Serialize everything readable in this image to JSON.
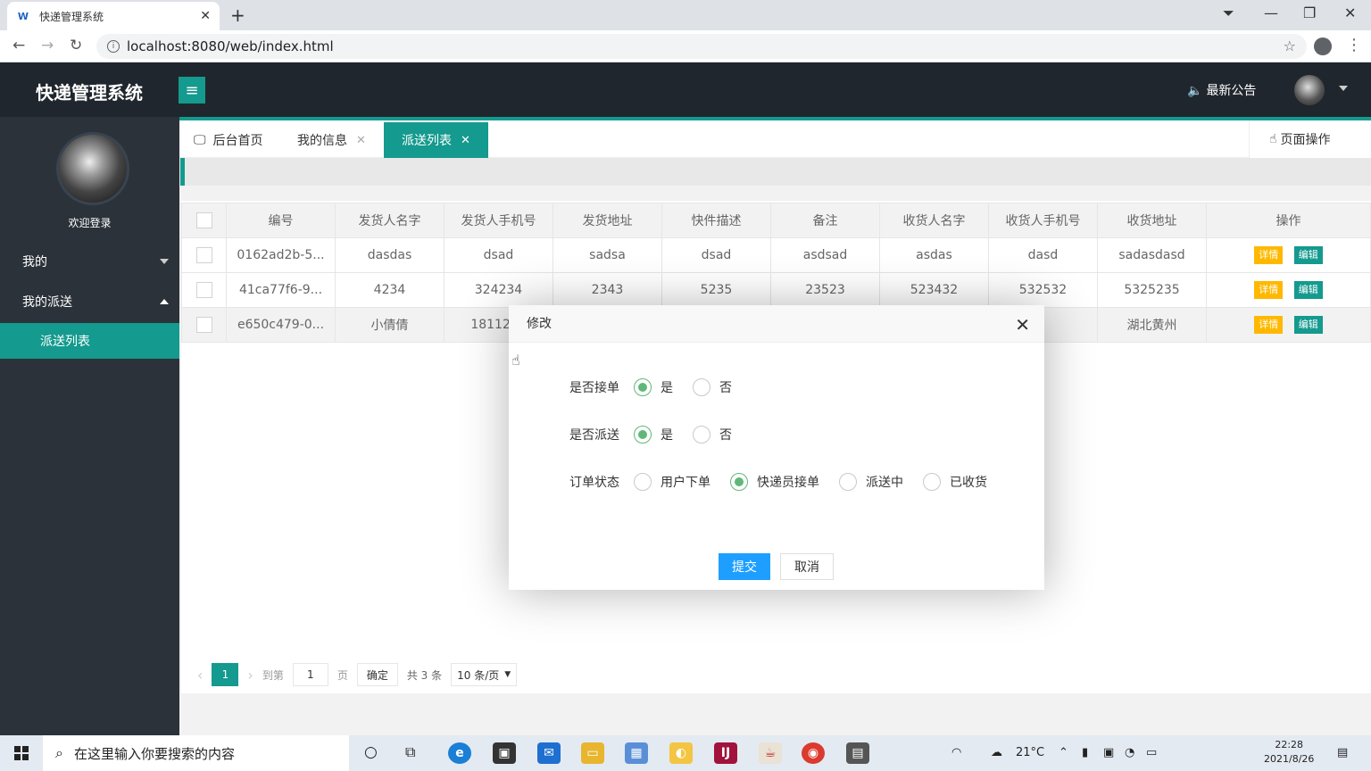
{
  "browser": {
    "tab_title": "快递管理系统",
    "tab_close": "✕",
    "new_tab": "+",
    "url": "localhost:8080/web/index.html"
  },
  "header": {
    "app_title": "快递管理系统",
    "menu_icon": "≡",
    "notice": "最新公告"
  },
  "sidebar": {
    "welcome": "欢迎登录",
    "items": [
      {
        "label": "我的"
      },
      {
        "label": "我的派送"
      }
    ],
    "sub_item": "派送列表"
  },
  "tabs": {
    "items": [
      {
        "label": "后台首页"
      },
      {
        "label": "我的信息"
      },
      {
        "label": "派送列表"
      }
    ],
    "close": "✕",
    "page_ops": "页面操作"
  },
  "table": {
    "columns": [
      "编号",
      "发货人名字",
      "发货人手机号",
      "发货地址",
      "快件描述",
      "备注",
      "收货人名字",
      "收货人手机号",
      "收货地址",
      "操作"
    ],
    "rows": [
      [
        "0162ad2b-5...",
        "dasdas",
        "dsad",
        "sadsa",
        "dsad",
        "asdsad",
        "asdas",
        "dasd",
        "sadasdasd"
      ],
      [
        "41ca77f6-9...",
        "4234",
        "324234",
        "2343",
        "5235",
        "23523",
        "523432",
        "532532",
        "5325235"
      ],
      [
        "e650c479-0...",
        "小倩倩",
        "1811234",
        "",
        "",
        "",
        "",
        "12222",
        "湖北黄州"
      ]
    ],
    "detail_btn": "详情",
    "edit_btn": "编辑"
  },
  "pager": {
    "prev": "‹",
    "current": "1",
    "next": "›",
    "goto_label": "到第",
    "goto_value": "1",
    "page_label": "页",
    "ok": "确定",
    "total": "共 3 条",
    "page_size": "10 条/页"
  },
  "modal": {
    "title": "修改",
    "close": "✕",
    "fields": [
      {
        "label": "是否接单",
        "options": [
          "是",
          "否"
        ],
        "selected": 0
      },
      {
        "label": "是否派送",
        "options": [
          "是",
          "否"
        ],
        "selected": 0
      },
      {
        "label": "订单状态",
        "options": [
          "用户下单",
          "快递员接单",
          "派送中",
          "已收货"
        ],
        "selected": 1
      }
    ],
    "submit": "提交",
    "cancel": "取消"
  },
  "taskbar": {
    "search_placeholder": "在这里输入你要搜索的内容",
    "temp": "21°C",
    "time": "22:28",
    "date": "2021/8/26"
  },
  "colors": {
    "primary": "#149a8e",
    "sidebar": "#2b323a",
    "header": "#20262d",
    "warning": "#ffb800",
    "submit": "#1e9fff"
  }
}
